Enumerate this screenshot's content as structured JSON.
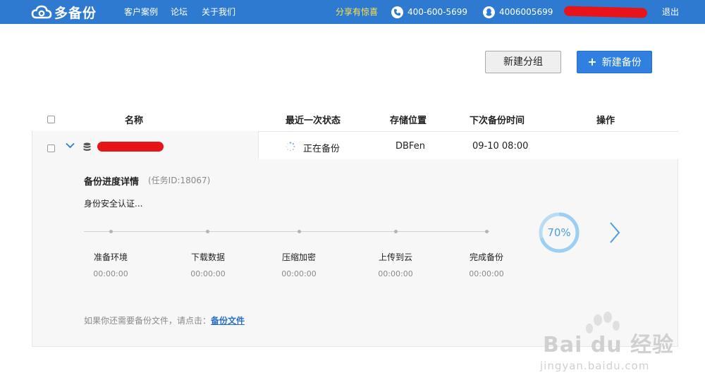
{
  "header": {
    "brand": "多备份",
    "nav": [
      "客户案例",
      "论坛",
      "关于我们"
    ],
    "promo": "分享有惊喜",
    "phone": "400-600-5699",
    "qq": "4006005699",
    "logout": "退出",
    "brand_color": "#2e7ad0"
  },
  "toolbar": {
    "new_group": "新建分组",
    "new_backup": "新建备份",
    "new_backup_icon": "plus-icon"
  },
  "table": {
    "columns": [
      "名称",
      "最近一次状态",
      "存储位置",
      "下次备份时间",
      "操作"
    ],
    "row": {
      "status": "正在备份",
      "storage": "DBFen",
      "next_time": "09-10 08:00"
    }
  },
  "detail": {
    "title": "备份进度详情",
    "task_id": "(任务ID:18067)",
    "current_status": "身份安全认证...",
    "steps": [
      {
        "label": "准备环境",
        "time": "00:00:00"
      },
      {
        "label": "下载数据",
        "time": "00:00:00"
      },
      {
        "label": "压缩加密",
        "time": "00:00:00"
      },
      {
        "label": "上传到云",
        "time": "00:00:00"
      },
      {
        "label": "完成备份",
        "time": "00:00:00"
      }
    ],
    "progress_percent": 70,
    "progress_text": "70%",
    "footnote_text": "如果你还需要备份文件，请点击：",
    "footnote_link": "备份文件"
  },
  "watermark": {
    "text": "Bai du 经验",
    "url": "jingyan.baidu.com"
  }
}
